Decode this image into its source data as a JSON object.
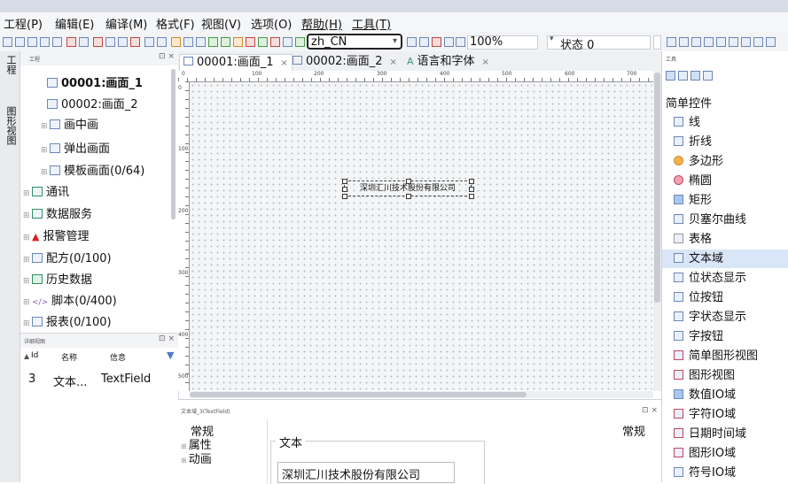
{
  "menubar": {
    "items": [
      "工程(P)",
      "编辑(E)",
      "编译(M)",
      "格式(F)",
      "视图(V)",
      "选项(O)",
      "帮助(H)",
      "工具(T)"
    ]
  },
  "toolbar": {
    "locale_value": "zh_CN",
    "zoom_value": "100%",
    "state_value": "状态 0"
  },
  "left_tabs": [
    "工程",
    "图形视图"
  ],
  "project_panel": {
    "title": "工程",
    "close_glyph": "⊡ ×",
    "items": [
      {
        "label": "00001:画面_1",
        "bold": true
      },
      {
        "label": "00002:画面_2",
        "bold": false
      },
      {
        "label": "画中画"
      },
      {
        "label": "弹出画面"
      },
      {
        "label": "模板画面(0/64)"
      },
      {
        "label": "通讯"
      },
      {
        "label": "数据服务"
      },
      {
        "label": "报警管理"
      },
      {
        "label": "配方(0/100)"
      },
      {
        "label": "历史数据"
      },
      {
        "label": "脚本(0/400)"
      },
      {
        "label": "报表(0/100)"
      }
    ]
  },
  "detail_panel": {
    "title": "详细视图",
    "close_glyph": "⊡ ×",
    "columns": [
      "Id",
      "名称",
      "信息"
    ],
    "rows": [
      {
        "id": "3",
        "name": "文本...",
        "info": "TextField"
      }
    ]
  },
  "editor_tabs": [
    {
      "label": "00001:画面_1",
      "close": "×"
    },
    {
      "label": "00002:画面_2",
      "close": "×"
    },
    {
      "label": "语言和字体",
      "close": "×"
    }
  ],
  "ruler": {
    "top_ticks": [
      "0",
      "100",
      "200",
      "300",
      "400",
      "500",
      "600",
      "700"
    ],
    "left_ticks": [
      "0",
      "100",
      "200",
      "300",
      "400",
      "500",
      "600"
    ]
  },
  "canvas": {
    "text_field": "深圳汇川技术股份有限公司"
  },
  "properties": {
    "title": "文本域_3(TextField)",
    "close_glyph": "⊡ ×",
    "nav": [
      "常规",
      "属性",
      "动画"
    ],
    "section_title": "常规",
    "group_label": "文本",
    "text_value": "深圳汇川技术股份有限公司"
  },
  "toolbox": {
    "title": "工具",
    "category": "简单控件",
    "items": [
      "线",
      "折线",
      "多边形",
      "椭圆",
      "矩形",
      "贝塞尔曲线",
      "表格",
      "文本域",
      "位状态显示",
      "位按钮",
      "字状态显示",
      "字按钮",
      "简单图形视图",
      "图形视图",
      "数值IO域",
      "字符IO域",
      "日期时间域",
      "图形IO域",
      "符号IO域"
    ],
    "selected": "文本域"
  }
}
